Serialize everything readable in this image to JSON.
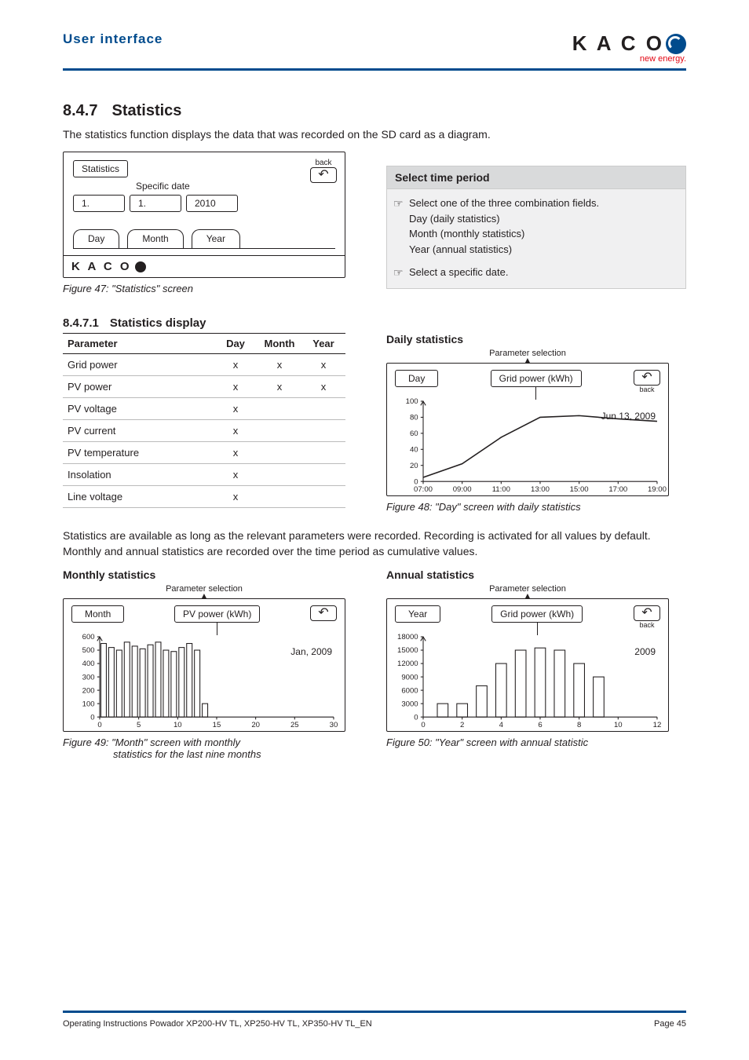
{
  "header": {
    "title": "User interface",
    "logo_text": "K A C O",
    "logo_sub": "new energy."
  },
  "section": {
    "num": "8.4.7",
    "title": "Statistics",
    "intro": "The statistics function displays the data that was recorded on the SD card as a diagram."
  },
  "fig47": {
    "title": "Statistics",
    "back": "back",
    "spec_date": "Specific date",
    "d1": "1.",
    "d2": "1.",
    "d3": "2010",
    "tab_day": "Day",
    "tab_month": "Month",
    "tab_year": "Year",
    "brand": "K A C O",
    "caption": "Figure 47: \"Statistics\" screen"
  },
  "infobox": {
    "title": "Select time period",
    "line1": "Select one of the three combination fields.",
    "line2": "Day (daily statistics)",
    "line3": "Month (monthly statistics)",
    "line4": "Year (annual statistics)",
    "line5": "Select a specific date."
  },
  "sub": {
    "num": "8.4.7.1",
    "title": "Statistics display"
  },
  "table": {
    "h_param": "Parameter",
    "h_day": "Day",
    "h_month": "Month",
    "h_year": "Year",
    "rows": [
      {
        "p": "Grid power",
        "d": "x",
        "m": "x",
        "y": "x"
      },
      {
        "p": "PV power",
        "d": "x",
        "m": "x",
        "y": "x"
      },
      {
        "p": "PV voltage",
        "d": "x",
        "m": "",
        "y": ""
      },
      {
        "p": "PV current",
        "d": "x",
        "m": "",
        "y": ""
      },
      {
        "p": "PV temperature",
        "d": "x",
        "m": "",
        "y": ""
      },
      {
        "p": "Insolation",
        "d": "x",
        "m": "",
        "y": ""
      },
      {
        "p": "Line voltage",
        "d": "x",
        "m": "",
        "y": ""
      }
    ]
  },
  "daily": {
    "heading": "Daily statistics",
    "ps": "Parameter selection",
    "mode": "Day",
    "sel": "Grid power (kWh)",
    "back": "back",
    "date": "Jun 13, 2009",
    "caption": "Figure 48: \"Day\" screen with daily statistics"
  },
  "mid_text": "Statistics are available as long as the relevant parameters were recorded. Recording is activated for all values by default. Monthly and annual statistics are recorded over the time period as cumulative values.",
  "monthly": {
    "heading": "Monthly statistics",
    "ps": "Parameter selection",
    "mode": "Month",
    "sel": "PV power (kWh)",
    "date": "Jan, 2009",
    "caption1": "Figure 49: \"Month\" screen with monthly",
    "caption2": "statistics for the last nine months"
  },
  "annual": {
    "heading": "Annual statistics",
    "ps": "Parameter selection",
    "mode": "Year",
    "sel": "Grid power (kWh)",
    "back": "back",
    "date": "2009",
    "caption": "Figure 50: \"Year\" screen with annual statistic"
  },
  "chart_data": [
    {
      "type": "line",
      "id": "fig48_daily",
      "title": "Grid power (kWh) — Jun 13, 2009",
      "xlabel": "",
      "ylabel": "",
      "x": [
        "07:00",
        "09:00",
        "11:00",
        "13:00",
        "15:00",
        "17:00",
        "19:00"
      ],
      "values": [
        5,
        22,
        55,
        80,
        82,
        78,
        75
      ],
      "ylim": [
        0,
        100
      ],
      "yticks": [
        0,
        20,
        40,
        60,
        80,
        100
      ]
    },
    {
      "type": "bar",
      "id": "fig49_monthly",
      "title": "PV power (kWh) — Jan, 2009",
      "xlabel": "",
      "ylabel": "",
      "categories": [
        0,
        5,
        10,
        15,
        20,
        25,
        30
      ],
      "values": [
        550,
        520,
        500,
        560,
        530,
        510,
        540,
        560,
        500,
        490,
        520,
        550,
        500,
        100
      ],
      "ylim": [
        0,
        600
      ],
      "yticks": [
        0,
        100,
        200,
        300,
        400,
        500,
        600
      ],
      "note": "14 daily bars shown covering x≈1..14"
    },
    {
      "type": "bar",
      "id": "fig50_annual",
      "title": "Grid power (kWh) — 2009",
      "xlabel": "",
      "ylabel": "",
      "categories": [
        0,
        2,
        4,
        6,
        8,
        10,
        12
      ],
      "x": [
        1,
        2,
        3,
        4,
        5,
        6,
        7,
        8,
        9
      ],
      "values": [
        3000,
        3000,
        7000,
        12000,
        15000,
        15500,
        15000,
        12000,
        9000
      ],
      "ylim": [
        0,
        18000
      ],
      "yticks": [
        0,
        3000,
        6000,
        9000,
        12000,
        15000,
        18000
      ]
    }
  ],
  "footer": {
    "left": "Operating Instructions Powador XP200-HV TL, XP250-HV TL, XP350-HV TL_EN",
    "right": "Page 45"
  }
}
